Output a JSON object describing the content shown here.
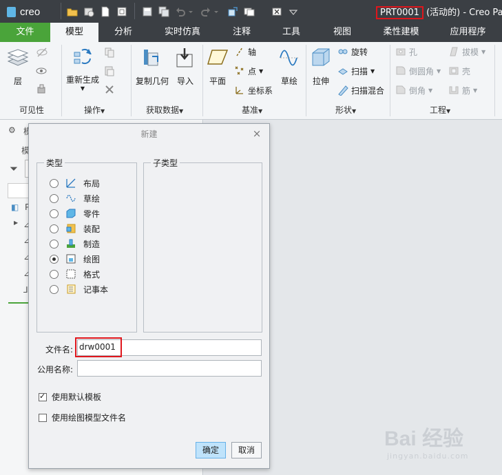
{
  "app": {
    "logo": "creo",
    "title_highlight": "PRT0001",
    "title_rest": " (活动的) - Creo Pa"
  },
  "tabs": [
    "文件",
    "模型",
    "分析",
    "实时仿真",
    "注释",
    "工具",
    "视图",
    "柔性建模",
    "应用程序"
  ],
  "ribbon": {
    "groups": {
      "visibility": "可见性",
      "operations": "操作",
      "get_data": "获取数据",
      "datum": "基准",
      "shapes": "形状",
      "engineering": "工程"
    },
    "buttons": {
      "layer": "层",
      "regenerate": "重新生成",
      "copy_geometry": "复制几何",
      "import": "导入",
      "plane": "平面",
      "axis": "轴",
      "point": "点",
      "csys": "坐标系",
      "sketch": "草绘",
      "extrude": "拉伸",
      "revolve": "旋转",
      "sweep": "扫描",
      "swept_blend": "扫描混合",
      "hole": "孔",
      "round": "倒圆角",
      "chamfer": "倒角",
      "draft": "拔模",
      "shell": "壳",
      "rib": "筋"
    }
  },
  "tree": {
    "label_top": "模",
    "label_2": "模",
    "row_p": "P"
  },
  "dialog": {
    "title": "新建",
    "type_label": "类型",
    "subtype_label": "子类型",
    "types": [
      {
        "label": "布局",
        "selected": false
      },
      {
        "label": "草绘",
        "selected": false
      },
      {
        "label": "零件",
        "selected": false
      },
      {
        "label": "装配",
        "selected": false
      },
      {
        "label": "制造",
        "selected": false
      },
      {
        "label": "绘图",
        "selected": true
      },
      {
        "label": "格式",
        "selected": false
      },
      {
        "label": "记事本",
        "selected": false
      }
    ],
    "filename_label": "文件名:",
    "filename_value": "drw0001",
    "common_name_label": "公用名称:",
    "common_name_value": "",
    "use_default_template": "使用默认模板",
    "use_drawing_model_name": "使用绘图模型文件名",
    "ok": "确定",
    "cancel": "取消"
  },
  "watermark": {
    "main": "Bai 经验",
    "sub": "jingyan.baidu.com"
  },
  "colors": {
    "accent_green": "#4aa43a",
    "highlight_red": "#e0161c",
    "primary_button": "#bfe3fb"
  }
}
